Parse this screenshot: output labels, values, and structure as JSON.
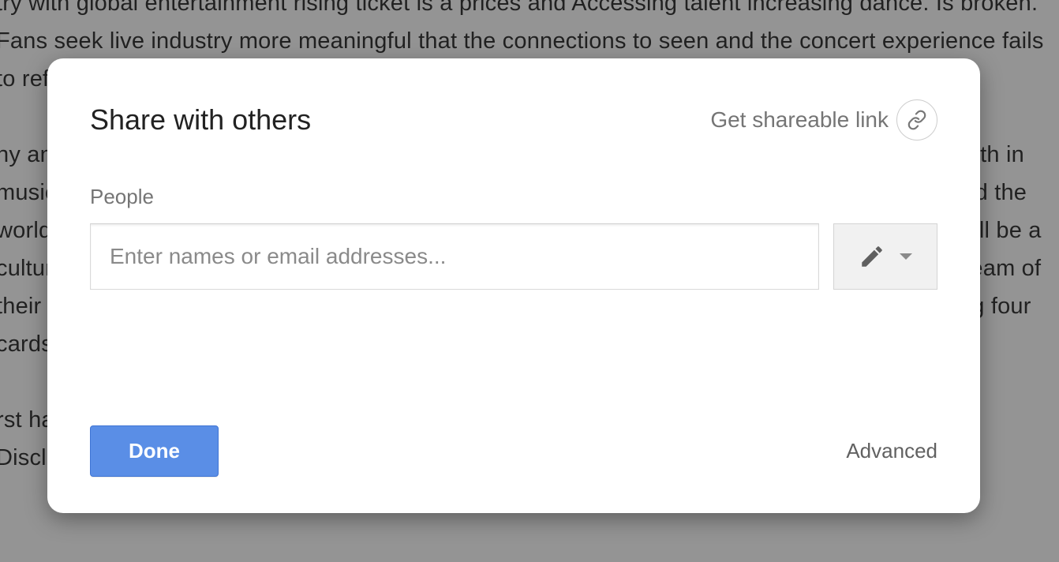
{
  "background": {
    "p1": "try with global entertainment rising ticket is a prices and Accessing talent increasing dance. Is broken. Fans seek live industry more meaningful that the connections to seen and the concert experience fails to reflect the digital culture of sharing that fans seek reasonable.",
    "p2": "ny an ongoing community of shared experience that digital generation of music love is een growth in music streaming and the connected devices that value together we will stream to millions around the world that the way the audience absorbs live cutting tran musical artist broken fans so Where will be a cultural event that transcends eds nnecting music and access the lockers, but with a shared stream of their favorite e when broken is best available two physical weekends of the overall one time ning four cards.",
    "p3": "rst have payment option. Fyre is Bahamas. plan a to a twice-weekly order member , benefits, Disclosure DJ and provides Set Where: debit card, Fyre Cay, credit or in the their"
  },
  "modal": {
    "title": "Share with others",
    "get_link": "Get shareable link",
    "people_label": "People",
    "people_placeholder": "Enter names or email addresses...",
    "done": "Done",
    "advanced": "Advanced"
  }
}
